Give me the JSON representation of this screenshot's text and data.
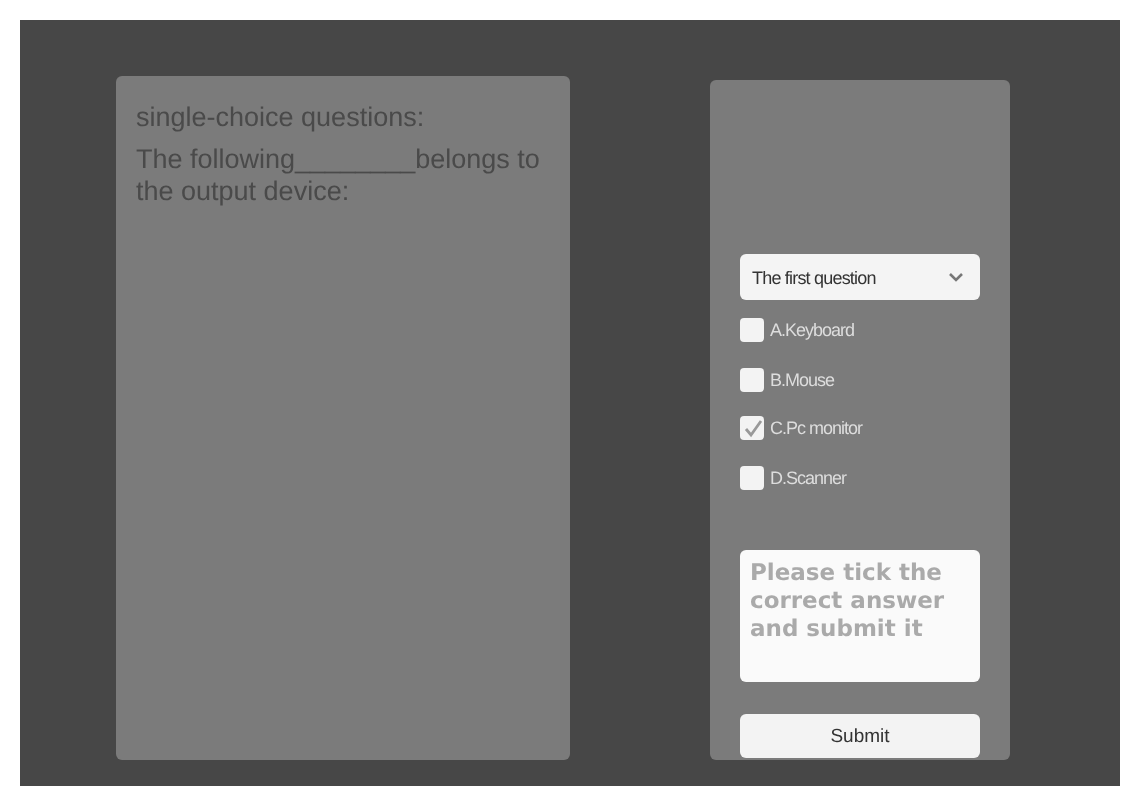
{
  "question_panel": {
    "heading": "single-choice questions:",
    "question": "The following________belongs to the output device:"
  },
  "answer_panel": {
    "dropdown": {
      "value": "The first question"
    },
    "options": [
      {
        "label": "A.Keyboard",
        "checked": false
      },
      {
        "label": "B.Mouse",
        "checked": false
      },
      {
        "label": "C.Pc monitor",
        "checked": true
      },
      {
        "label": "D.Scanner",
        "checked": false
      }
    ],
    "answer_box": {
      "placeholder": "Please tick the correct answer and submit it"
    },
    "submit_button": "Submit"
  }
}
